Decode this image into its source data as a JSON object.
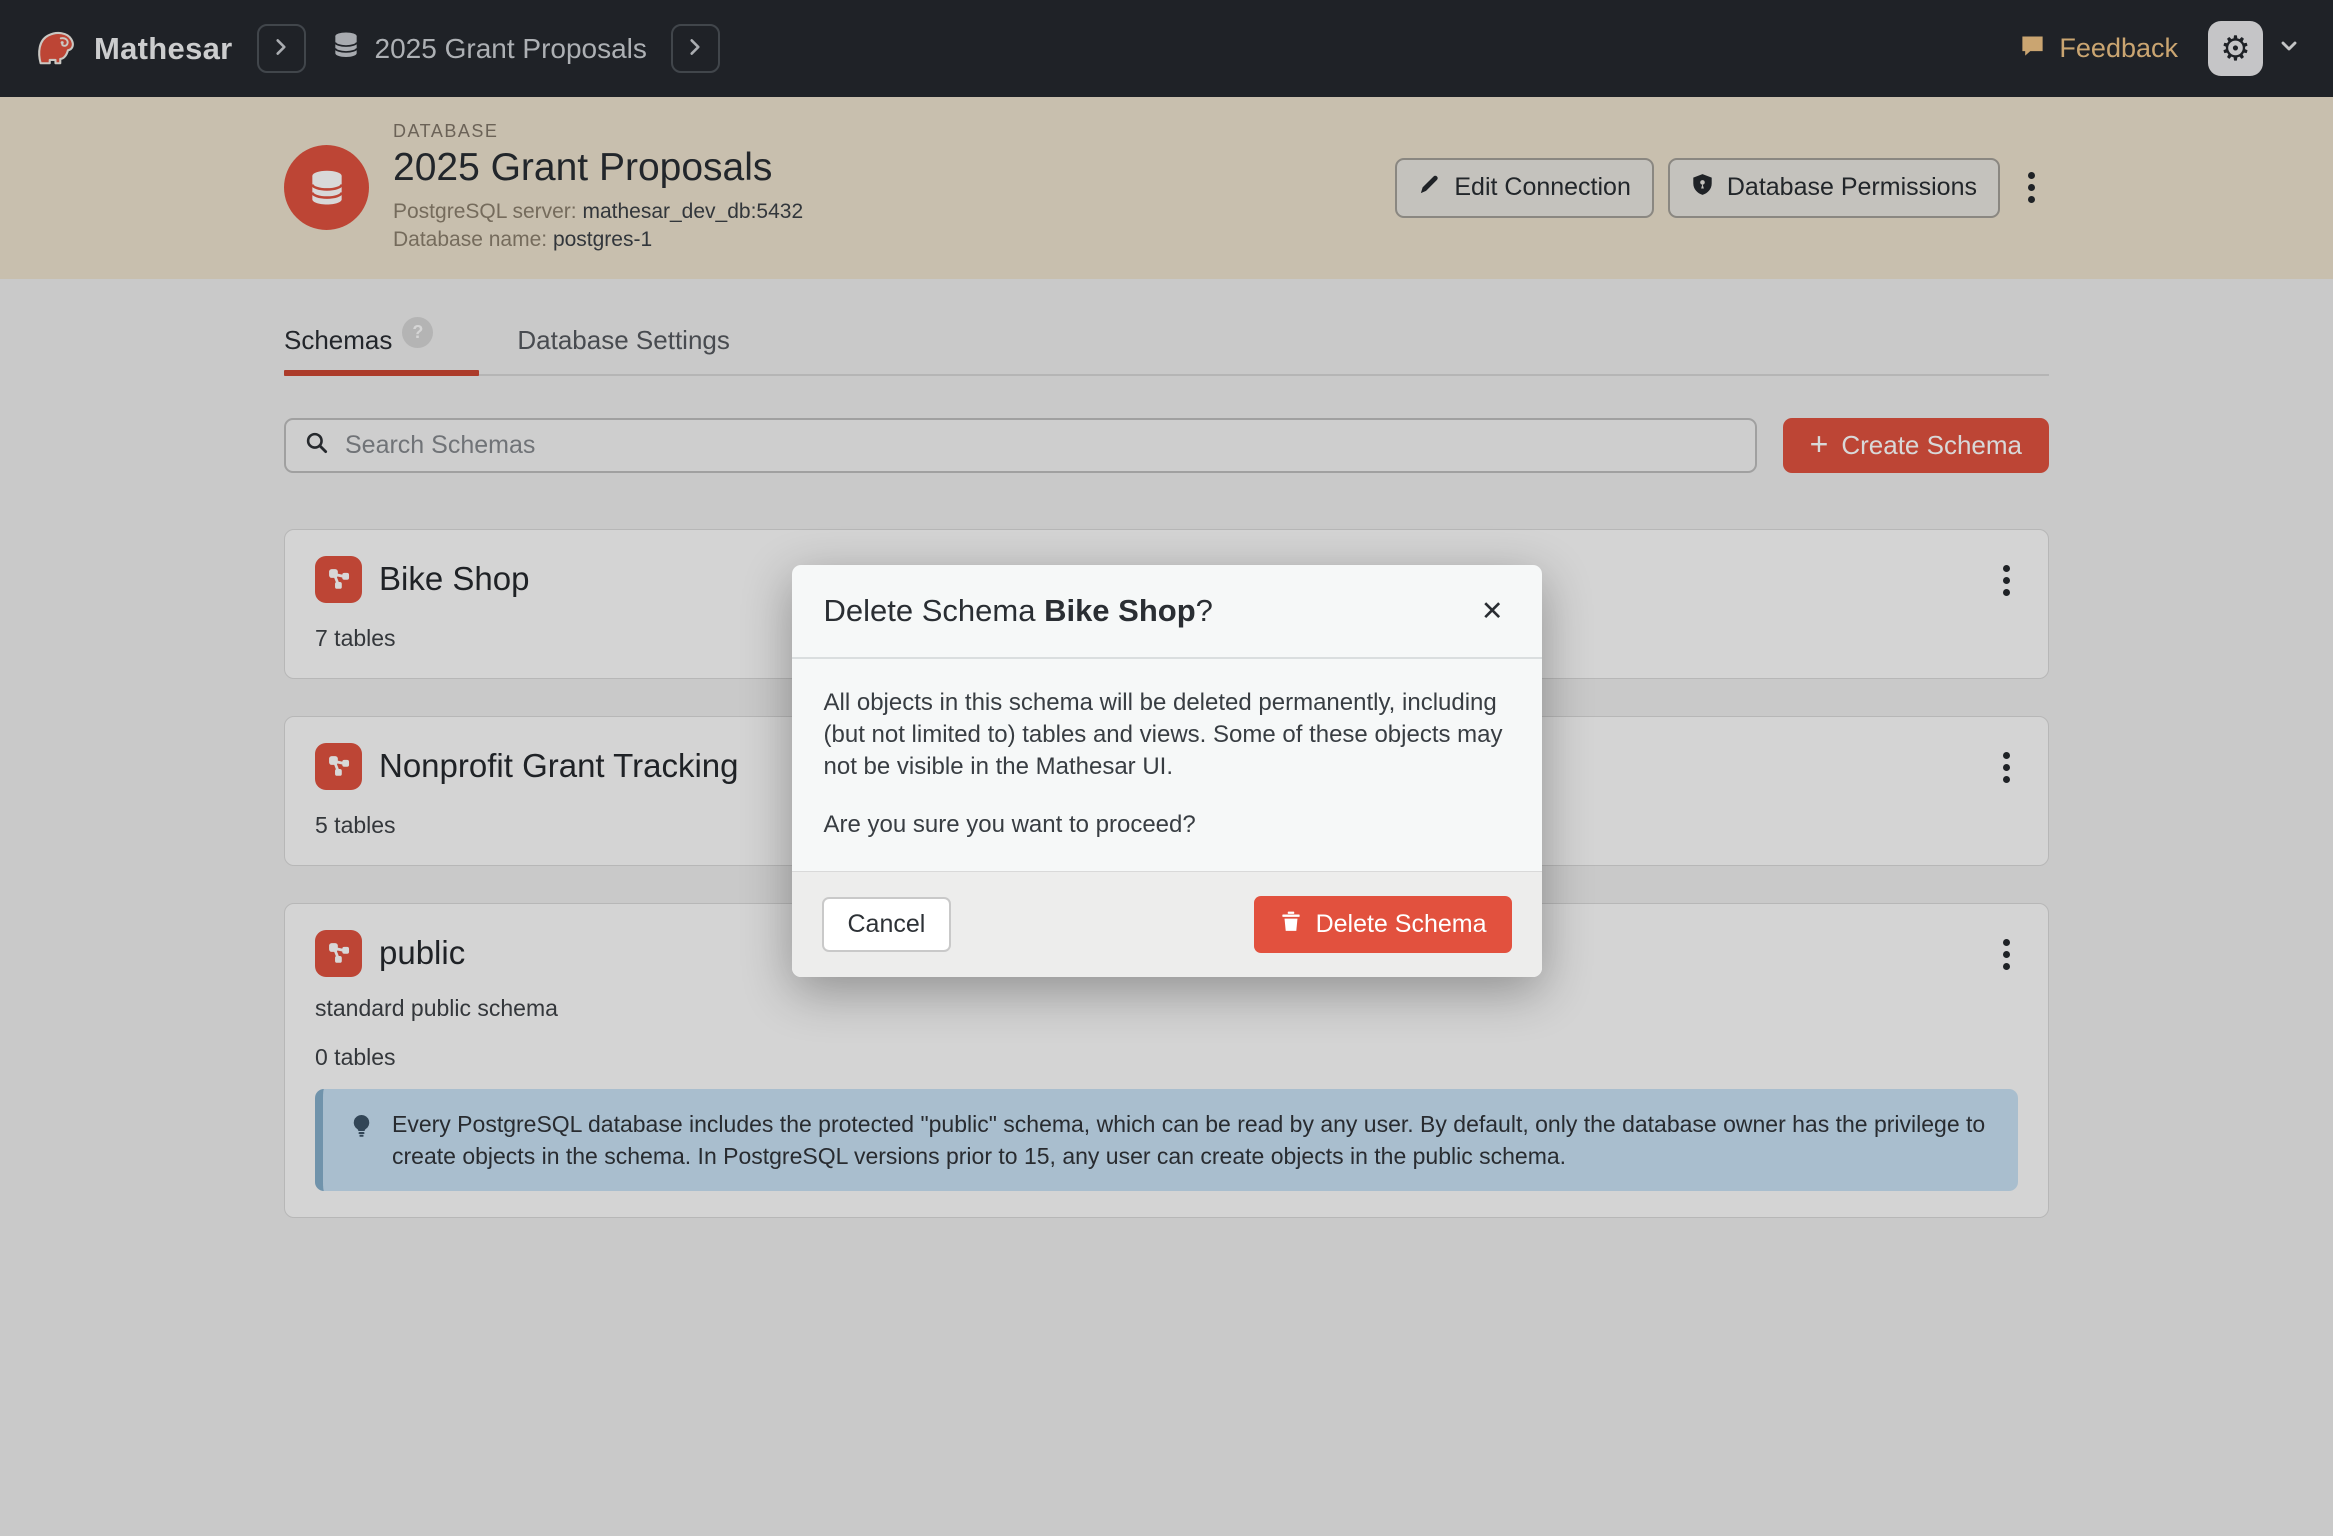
{
  "nav": {
    "brand": "Mathesar",
    "breadcrumb": "2025 Grant Proposals",
    "feedback": "Feedback"
  },
  "header": {
    "eyebrow": "DATABASE",
    "title": "2025 Grant Proposals",
    "server_label": "PostgreSQL server: ",
    "server_value": "mathesar_dev_db:5432",
    "dbname_label": "Database name: ",
    "dbname_value": "postgres-1",
    "edit_connection": "Edit Connection",
    "database_permissions": "Database Permissions"
  },
  "tabs": {
    "schemas": "Schemas",
    "schemas_help": "?",
    "database_settings": "Database Settings"
  },
  "toolbar": {
    "search_placeholder": "Search Schemas",
    "plus": "+",
    "create_schema": "Create Schema"
  },
  "schemas": {
    "items": [
      {
        "name": "Bike Shop",
        "tables": "7 tables"
      },
      {
        "name": "Nonprofit Grant Tracking",
        "tables": "5 tables"
      },
      {
        "name": "public",
        "description": "standard public schema",
        "tables": "0 tables",
        "note": "Every PostgreSQL database includes the protected \"public\" schema, which can be read by any user. By default, only the database owner has the privilege to create objects in the schema. In PostgreSQL versions prior to 15, any user can create objects in the public schema."
      }
    ]
  },
  "modal": {
    "title_prefix": "Delete Schema ",
    "title_schema": "Bike Shop",
    "title_suffix": "?",
    "close": "✕",
    "body_paragraph_1": "All objects in this schema will be deleted permanently, including (but not limited to) tables and views. Some of these objects may not be visible in the Mathesar UI.",
    "body_paragraph_2": "Are you sure you want to proceed?",
    "cancel": "Cancel",
    "confirm": "Delete Schema"
  },
  "colors": {
    "nav_bg": "#23272d",
    "header_sand": "#ece2cd",
    "brand_red": "#df503d",
    "delete_red": "#e2513e",
    "tab_underline": "#cb4430",
    "feedback_gold": "#efc385",
    "note_blue_bg": "#c8e1f3",
    "note_blue_border": "#84adca"
  }
}
